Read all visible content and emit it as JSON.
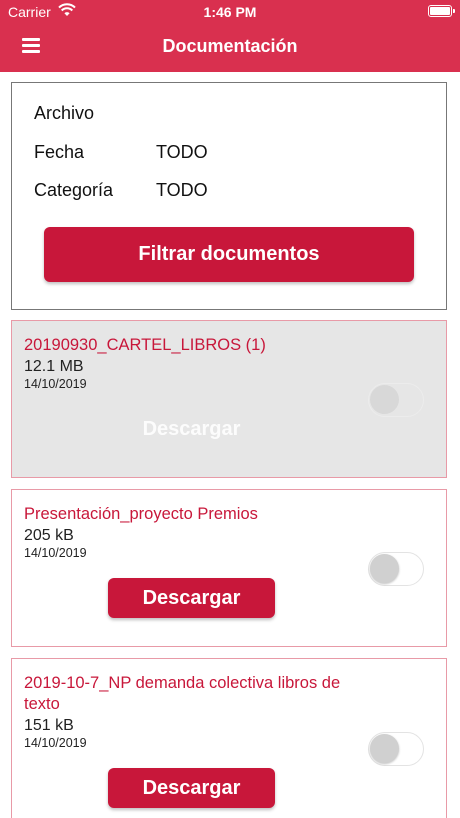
{
  "status_bar": {
    "carrier": "Carrier",
    "time": "1:46 PM",
    "icons": [
      "wifi-icon",
      "battery-icon"
    ]
  },
  "nav": {
    "title": "Documentación",
    "menu_icon": "hamburger-menu-icon"
  },
  "filter": {
    "rows": [
      {
        "label": "Archivo",
        "value": ""
      },
      {
        "label": "Fecha",
        "value": "TODO"
      },
      {
        "label": "Categoría",
        "value": "TODO"
      }
    ],
    "button_label": "Filtrar documentos"
  },
  "documents": [
    {
      "title": "20190930_CARTEL_LIBROS (1)",
      "size": "12.1 MB",
      "date": "14/10/2019",
      "download_label": "Descargar",
      "toggle_on": false,
      "state": "pressed"
    },
    {
      "title": "Presentación_proyecto Premios",
      "size": "205 kB",
      "date": "14/10/2019",
      "download_label": "Descargar",
      "toggle_on": false,
      "state": "normal"
    },
    {
      "title": "2019-10-7_NP demanda colectiva libros de texto",
      "size": "151 kB",
      "date": "14/10/2019",
      "download_label": "Descargar",
      "toggle_on": false,
      "state": "normal"
    }
  ],
  "colors": {
    "nav_background": "#d9304f",
    "button_background": "#c8173a",
    "title_color": "#c8173a",
    "card_border": "#e89aa7"
  }
}
